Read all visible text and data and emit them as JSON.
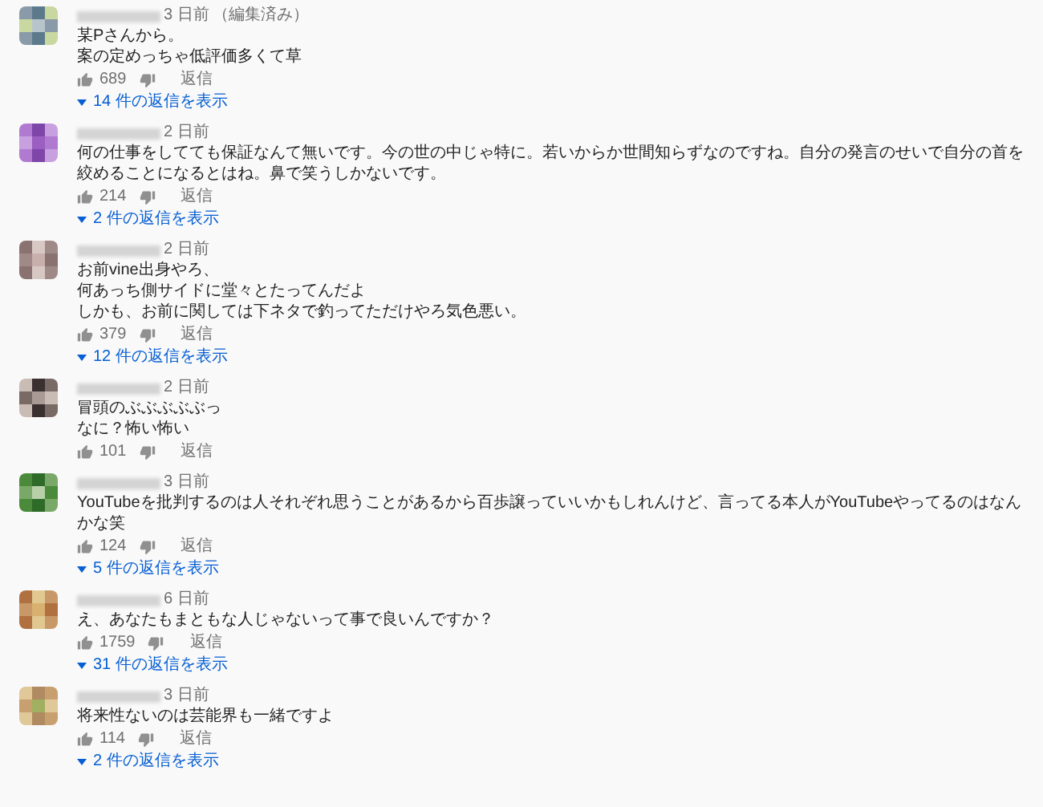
{
  "comments": [
    {
      "time": "3 日前",
      "edited": "（編集済み）",
      "lines": [
        "某Pさんから。",
        "案の定めっちゃ低評価多くて草"
      ],
      "likes": "689",
      "reply": "返信",
      "replies": "14 件の返信を表示"
    },
    {
      "time": "2 日前",
      "lines": [
        "何の仕事をしてても保証なんて無いです。今の世の中じゃ特に。若いからか世間知らずなのですね。自分の発言のせいで自分の首を絞めることになるとはね。鼻で笑うしかないです。"
      ],
      "likes": "214",
      "reply": "返信",
      "replies": "2 件の返信を表示"
    },
    {
      "time": "2 日前",
      "lines": [
        "お前vine出身やろ、",
        "何あっち側サイドに堂々とたってんだよ",
        "しかも、お前に関しては下ネタで釣ってただけやろ気色悪い。"
      ],
      "likes": "379",
      "reply": "返信",
      "replies": "12 件の返信を表示"
    },
    {
      "time": "2 日前",
      "lines": [
        "冒頭のぶぶぶぶぶっ",
        "なに？怖い怖い"
      ],
      "likes": "101",
      "reply": "返信"
    },
    {
      "time": "3 日前",
      "lines": [
        "YouTubeを批判するのは人それぞれ思うことがあるから百歩譲っていいかもしれんけど、言ってる本人がYouTubeやってるのはなんかな笑"
      ],
      "likes": "124",
      "reply": "返信",
      "replies": "5 件の返信を表示"
    },
    {
      "time": "6 日前",
      "lines": [
        "え、あなたもまともな人じゃないって事で良いんですか？"
      ],
      "likes": "1759",
      "reply": "返信",
      "replies": "31 件の返信を表示"
    },
    {
      "time": "3 日前",
      "lines": [
        "将来性ないのは芸能界も一緒ですよ"
      ],
      "likes": "114",
      "reply": "返信",
      "replies": "2 件の返信を表示"
    }
  ]
}
